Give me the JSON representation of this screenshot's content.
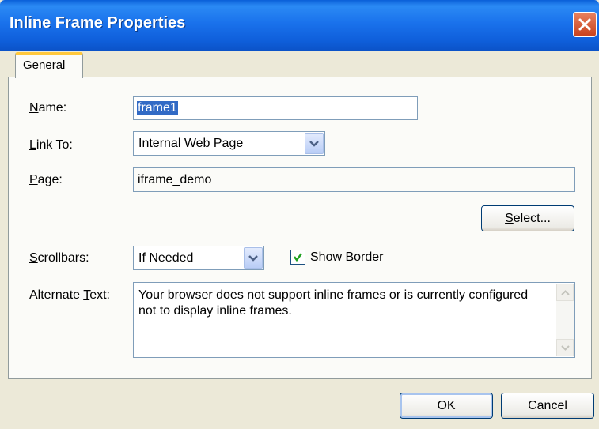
{
  "window": {
    "title": "Inline Frame Properties",
    "close_icon": "close-icon"
  },
  "tabs": [
    {
      "label": "General",
      "active": true
    }
  ],
  "form": {
    "name": {
      "label": "Name:",
      "mnemonic": "N",
      "rest": "ame:",
      "value": "frame1"
    },
    "link_to": {
      "label": "Link To:",
      "mnemonic": "L",
      "rest": "ink To:",
      "selected": "Internal Web Page"
    },
    "page": {
      "label": "Page:",
      "mnemonic": "P",
      "rest": "age:",
      "value": "iframe_demo"
    },
    "select_button": {
      "label": "Select...",
      "mnemonic": "S",
      "rest": "elect..."
    },
    "scrollbars": {
      "label": "Scrollbars:",
      "mnemonic": "S",
      "rest": "crollbars:",
      "selected": "If Needed"
    },
    "show_border": {
      "label": "Show Border",
      "pre": "Show ",
      "mnemonic": "B",
      "rest": "order",
      "checked": true
    },
    "alternate_text": {
      "label": "Alternate Text:",
      "pre": "Alternate ",
      "mnemonic": "T",
      "rest": "ext:",
      "value": "Your browser does not support inline frames or is currently configured not to display inline frames."
    }
  },
  "footer": {
    "ok_label": "OK",
    "cancel_label": "Cancel"
  },
  "colors": {
    "titlebar": "#0a5fd8",
    "close": "#c8411c",
    "dialog_bg": "#ece9d8",
    "tab_accent": "#ffc83c",
    "selection": "#316ac5"
  }
}
